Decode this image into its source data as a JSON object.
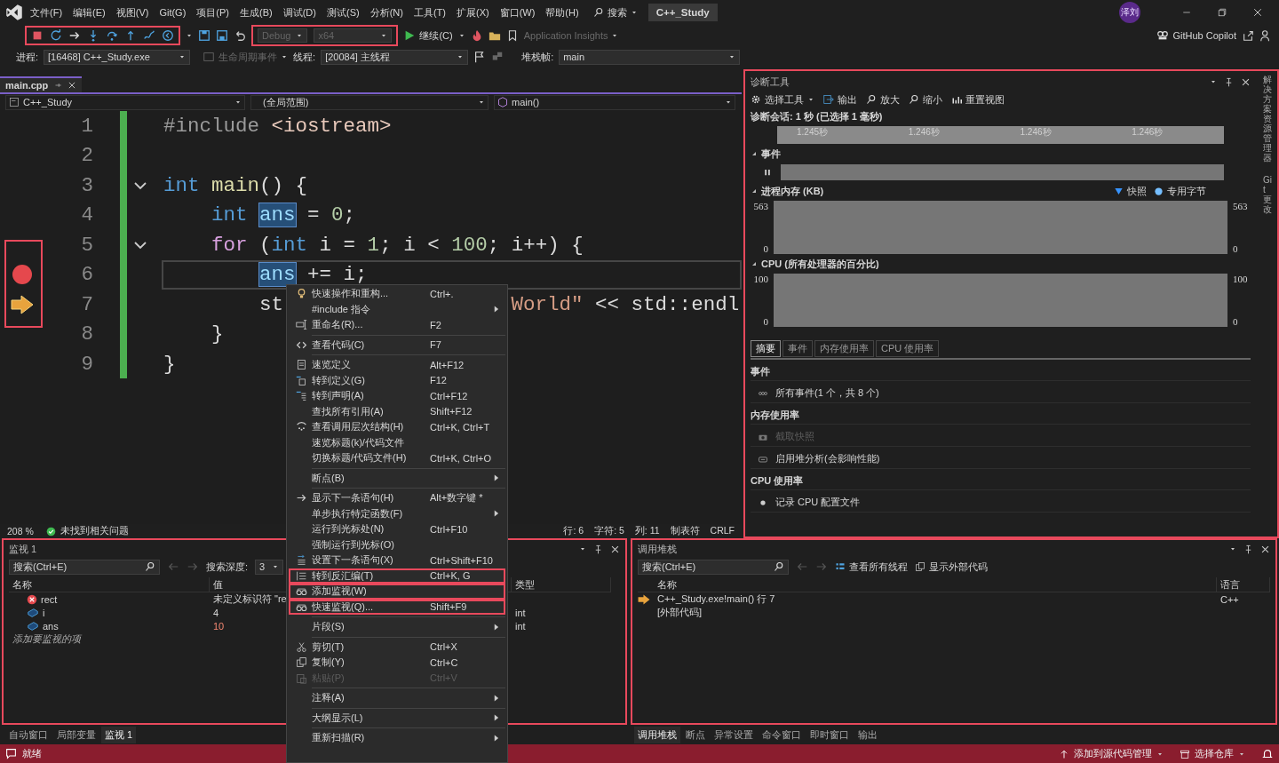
{
  "menubar": {
    "items": [
      "文件(F)",
      "编辑(E)",
      "视图(V)",
      "Git(G)",
      "项目(P)",
      "生成(B)",
      "调试(D)",
      "测试(S)",
      "分析(N)",
      "工具(T)",
      "扩展(X)",
      "窗口(W)",
      "帮助(H)"
    ],
    "search": "搜索",
    "solution": "C++_Study",
    "avatar": "泽刘"
  },
  "toolbar": {
    "debug_highlighted": true,
    "config_highlighted": true,
    "config": "Debug",
    "platform": "x64",
    "config_disabled": true,
    "continue": "继续(C)",
    "insights": "Application Insights",
    "copilot": "GitHub Copilot"
  },
  "debug_location": {
    "process_label": "进程:",
    "process": "[16468] C++_Study.exe",
    "lifecycle": "生命周期事件",
    "thread_label": "线程:",
    "thread": "[20084] 主线程",
    "frame_label": "堆栈帧:",
    "frame": "main"
  },
  "editor": {
    "tabs": [
      {
        "label": "main.cpp",
        "selected": true
      }
    ],
    "project": "C++_Study",
    "scope": "(全局范围)",
    "member": "main()",
    "gutter_highlighted": true,
    "lines": [
      {
        "number": "1",
        "tokens": [
          {
            "text": "#include",
            "kind": "pp"
          },
          {
            "text": " <iostream>",
            "kind": "inc"
          }
        ]
      },
      {
        "number": "2"
      },
      {
        "number": "3",
        "fold": true,
        "tokens": [
          {
            "text": "int",
            "kind": "kw"
          },
          {
            "text": " main",
            "kind": "fn"
          },
          {
            "text": "() {",
            "kind": "op"
          }
        ]
      },
      {
        "number": "4",
        "tokens": [
          {
            "text": "    int",
            "kind": "kw"
          },
          {
            "text": " ans",
            "kind": "ref"
          },
          {
            "text": " = ",
            "kind": "op"
          },
          {
            "text": "0",
            "kind": "num"
          },
          {
            "text": ";",
            "kind": "op"
          }
        ]
      },
      {
        "number": "5",
        "fold": true,
        "tokens": [
          {
            "text": "    for",
            "kind": "ctl"
          },
          {
            "text": " (",
            "kind": "op"
          },
          {
            "text": "int",
            "kind": "kw"
          },
          {
            "text": " i = ",
            "kind": "op"
          },
          {
            "text": "1",
            "kind": "num"
          },
          {
            "text": "; i < ",
            "kind": "op"
          },
          {
            "text": "100",
            "kind": "num"
          },
          {
            "text": "; i++) {",
            "kind": "op"
          }
        ]
      },
      {
        "number": "6",
        "breakpoint": true,
        "caret_line": true,
        "tokens": [
          {
            "text": "        ans",
            "kind": "ref"
          },
          {
            "text": " += i;",
            "kind": "op"
          }
        ]
      },
      {
        "number": "7",
        "current": true,
        "tokens": [
          {
            "text": "        st",
            "kind": "op"
          }
        ],
        "tail": [
          {
            "text": "World\"",
            "kind": "str"
          },
          {
            "text": " << std::endl",
            "kind": "op"
          }
        ]
      },
      {
        "number": "8",
        "tokens": [
          {
            "text": "    }",
            "kind": "op"
          }
        ]
      },
      {
        "number": "9",
        "tokens": [
          {
            "text": "}",
            "kind": "op"
          }
        ]
      }
    ],
    "status": {
      "zoom": "208 %",
      "issues": "未找到相关问题",
      "line": "行: 6",
      "char": "字符: 5",
      "col": "列: 11",
      "tabs": "制表符",
      "eol": "CRLF"
    }
  },
  "diagnostics": {
    "title": "诊断工具",
    "highlighted": true,
    "tools": [
      "选择工具",
      "输出",
      "放大",
      "缩小",
      "重置视图"
    ],
    "session": "诊断会话: 1 秒 (已选择 1 毫秒)",
    "ruler": [
      "1.245秒",
      "1.246秒",
      "1.246秒",
      "1.246秒"
    ],
    "events_title": "事件",
    "memory": {
      "title": "进程内存 (KB)",
      "legend": [
        "快照",
        "专用字节"
      ],
      "left_axis": [
        "563",
        "0"
      ],
      "right_axis": [
        "563",
        "0"
      ]
    },
    "cpu": {
      "title": "CPU (所有处理器的百分比)",
      "left_axis": [
        "100",
        "0"
      ],
      "right_axis": [
        "100",
        "0"
      ]
    },
    "tabs": [
      {
        "label": "摘要",
        "selected": true
      },
      {
        "label": "事件",
        "selected": false
      },
      {
        "label": "内存使用率",
        "selected": false
      },
      {
        "label": "CPU 使用率",
        "selected": false
      }
    ],
    "summary": [
      {
        "heading": "事件",
        "items": [
          {
            "label": "所有事件(1 个，共 8 个)",
            "kind": "events"
          }
        ]
      },
      {
        "heading": "内存使用率",
        "items": [
          {
            "label": "截取快照",
            "kind": "camera",
            "disabled": true
          },
          {
            "label": "启用堆分析(会影响性能)",
            "kind": "heap"
          }
        ]
      },
      {
        "heading": "CPU 使用率",
        "items": [
          {
            "label": "记录 CPU 配置文件",
            "kind": "record"
          }
        ]
      }
    ],
    "side_tabs": [
      "解决方案资源管理器",
      "Git 更改"
    ]
  },
  "context_menu": {
    "groups": [
      [
        {
          "label": "快速操作和重构...",
          "shortcut": "Ctrl+.",
          "kind": "bulb"
        },
        {
          "label": "#include 指令",
          "kind": "plain",
          "submenu": true
        },
        {
          "label": "重命名(R)...",
          "shortcut": "F2",
          "kind": "rename"
        }
      ],
      [
        {
          "label": "查看代码(C)",
          "shortcut": "F7",
          "kind": "code"
        }
      ],
      [
        {
          "label": "速览定义",
          "shortcut": "Alt+F12",
          "kind": "peek"
        },
        {
          "label": "转到定义(G)",
          "shortcut": "F12",
          "kind": "goto"
        },
        {
          "label": "转到声明(A)",
          "shortcut": "Ctrl+F12",
          "kind": "decl"
        },
        {
          "label": "查找所有引用(A)",
          "shortcut": "Shift+F12",
          "kind": "plain"
        },
        {
          "label": "查看调用层次结构(H)",
          "shortcut": "Ctrl+K, Ctrl+T",
          "kind": "hierarchy"
        },
        {
          "label": "速览标题(k)/代码文件",
          "kind": "plain"
        },
        {
          "label": "切换标题/代码文件(H)",
          "shortcut": "Ctrl+K, Ctrl+O",
          "kind": "plain"
        }
      ],
      [
        {
          "label": "断点(B)",
          "kind": "plain",
          "submenu": true
        }
      ],
      [
        {
          "label": "显示下一条语句(H)",
          "shortcut": "Alt+数字键 *",
          "kind": "arrow"
        },
        {
          "label": "单步执行特定函数(F)",
          "kind": "plain",
          "submenu": true
        },
        {
          "label": "运行到光标处(N)",
          "shortcut": "Ctrl+F10",
          "kind": "plain"
        },
        {
          "label": "强制运行到光标(O)",
          "kind": "plain"
        },
        {
          "label": "设置下一条语句(X)",
          "shortcut": "Ctrl+Shift+F10",
          "kind": "setnext"
        },
        {
          "label": "转到反汇编(T)",
          "shortcut": "Ctrl+K, G",
          "kind": "disasm",
          "highlighted": true
        },
        {
          "label": "添加监视(W)",
          "kind": "watch",
          "highlighted": true
        },
        {
          "label": "快速监视(Q)...",
          "shortcut": "Shift+F9",
          "kind": "watch",
          "highlighted": true
        }
      ],
      [
        {
          "label": "片段(S)",
          "kind": "plain",
          "submenu": true
        }
      ],
      [
        {
          "label": "剪切(T)",
          "shortcut": "Ctrl+X",
          "kind": "cut"
        },
        {
          "label": "复制(Y)",
          "shortcut": "Ctrl+C",
          "kind": "copy"
        },
        {
          "label": "粘贴(P)",
          "shortcut": "Ctrl+V",
          "kind": "paste",
          "disabled": true
        }
      ],
      [
        {
          "label": "注释(A)",
          "kind": "plain",
          "submenu": true
        }
      ],
      [
        {
          "label": "大纲显示(L)",
          "kind": "plain",
          "submenu": true
        }
      ],
      [
        {
          "label": "重新扫描(R)",
          "kind": "plain",
          "submenu": true
        }
      ]
    ]
  },
  "watch": {
    "title": "监视 1",
    "highlighted": true,
    "search": "搜索(Ctrl+E)",
    "depth_label": "搜索深度:",
    "depth": "3",
    "columns": [
      "名称",
      "值",
      "类型"
    ],
    "rows": [
      {
        "name": "rect",
        "kind": "error",
        "value": "未定义标识符 \"re"
      },
      {
        "name": "i",
        "kind": "variable",
        "value": "4",
        "type": "int"
      },
      {
        "name": "ans",
        "kind": "variable",
        "value": "10",
        "type": "int",
        "changed": true
      }
    ],
    "add_hint": "添加要监视的项",
    "tabs": [
      {
        "label": "自动窗口",
        "selected": false
      },
      {
        "label": "局部变量",
        "selected": false
      },
      {
        "label": "监视 1",
        "selected": true
      }
    ]
  },
  "call_stack": {
    "title": "调用堆栈",
    "highlighted": true,
    "search": "搜索(Ctrl+E)",
    "actions": [
      "查看所有线程",
      "显示外部代码"
    ],
    "columns": [
      "名称",
      "语言"
    ],
    "rows": [
      {
        "name": "C++_Study.exe!main() 行 7",
        "language": "C++",
        "current": true
      },
      {
        "name": "[外部代码]"
      }
    ],
    "tabs": [
      {
        "label": "调用堆栈",
        "selected": true
      },
      {
        "label": "断点",
        "selected": false
      },
      {
        "label": "异常设置",
        "selected": false
      },
      {
        "label": "命令窗口",
        "selected": false
      },
      {
        "label": "即时窗口",
        "selected": false
      },
      {
        "label": "输出",
        "selected": false
      }
    ]
  },
  "status_bar": {
    "ready": "就绪",
    "source_control": "添加到源代码管理",
    "repo": "选择仓库"
  }
}
